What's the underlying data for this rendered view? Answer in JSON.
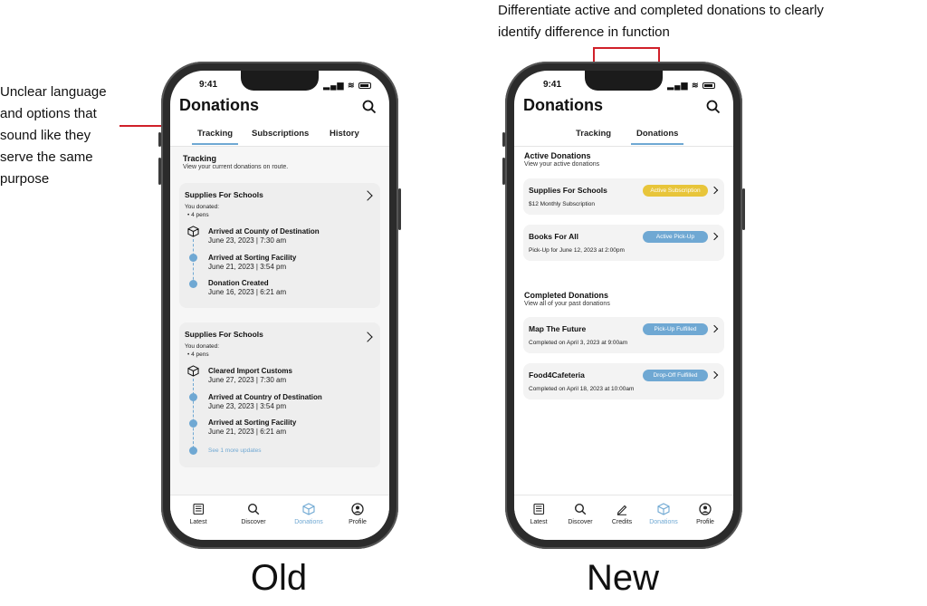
{
  "annotations": {
    "left": "Unclear language and options that sound like they serve the same purpose",
    "top": "Differentiate active and completed donations to clearly identify difference in function"
  },
  "captions": {
    "old": "Old",
    "new": "New"
  },
  "colors": {
    "accent": "#6fa8d3",
    "annotation_line": "#d0202a",
    "active_subscription": "#e8c53a"
  },
  "old": {
    "time": "9:41",
    "title": "Donations",
    "tabs": [
      "Tracking",
      "Subscriptions",
      "History"
    ],
    "section_title": "Tracking",
    "section_sub": "View your current donations on route.",
    "cards": [
      {
        "title": "Supplies For Schools",
        "donated_label": "You donated:",
        "item": "4 pens",
        "events": [
          {
            "title": "Arrived at County of Destination",
            "date": "June 23, 2023 | 7:30 am"
          },
          {
            "title": "Arrived at Sorting Facility",
            "date": "June 21, 2023 | 3:54 pm"
          },
          {
            "title": "Donation Created",
            "date": "June 16, 2023 | 6:21 am"
          }
        ]
      },
      {
        "title": "Supplies For Schools",
        "donated_label": "You donated:",
        "item": "4 pens",
        "events": [
          {
            "title": "Cleared Import Customs",
            "date": "June 27, 2023 | 7:30 am"
          },
          {
            "title": "Arrived at Country of Destination",
            "date": "June 23, 2023 | 3:54 pm"
          },
          {
            "title": "Arrived at Sorting Facility",
            "date": "June 21, 2023 | 6:21 am"
          }
        ],
        "more": "See 1 more updates"
      }
    ],
    "nav": [
      "Latest",
      "Discover",
      "Donations",
      "Profile"
    ]
  },
  "new": {
    "time": "9:41",
    "title": "Donations",
    "tabs": [
      "Tracking",
      "Donations"
    ],
    "active_section": {
      "title": "Active Donations",
      "sub": "View your active donations",
      "items": [
        {
          "title": "Supplies For Schools",
          "detail": "$12 Monthly Subscription",
          "badge": "Active Subscription"
        },
        {
          "title": "Books For All",
          "detail": "Pick-Up for June 12, 2023 at 2:00pm",
          "badge": "Active Pick-Up"
        }
      ]
    },
    "completed_section": {
      "title": "Completed Donations",
      "sub": "View all of your past donations",
      "items": [
        {
          "title": "Map The Future",
          "detail": "Completed on April 3, 2023 at 9:00am",
          "badge": "Pick-Up Fulfilled"
        },
        {
          "title": "Food4Cafeteria",
          "detail": "Completed on April 18, 2023 at 10:00am",
          "badge": "Drop-Off Fulfilled"
        }
      ]
    },
    "nav": [
      "Latest",
      "Discover",
      "Credits",
      "Donations",
      "Profile"
    ]
  }
}
